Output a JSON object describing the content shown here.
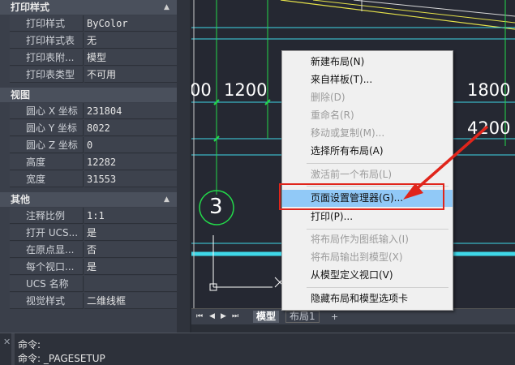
{
  "palette": {
    "sections": [
      {
        "title": "打印样式",
        "rows": [
          {
            "key": "打印样式",
            "value": "ByColor"
          },
          {
            "key": "打印样式表",
            "value": "无"
          },
          {
            "key": "打印表附...",
            "value": "模型"
          },
          {
            "key": "打印表类型",
            "value": "不可用"
          }
        ]
      },
      {
        "title": "视图",
        "rows": [
          {
            "key": "圆心 X 坐标",
            "value": "231804"
          },
          {
            "key": "圆心 Y 坐标",
            "value": "8022"
          },
          {
            "key": "圆心 Z 坐标",
            "value": "0"
          },
          {
            "key": "高度",
            "value": "12282"
          },
          {
            "key": "宽度",
            "value": "31553"
          }
        ]
      },
      {
        "title": "其他",
        "rows": [
          {
            "key": "注释比例",
            "value": "1:1"
          },
          {
            "key": "打开 UCS...",
            "value": "是"
          },
          {
            "key": "在原点显...",
            "value": "否"
          },
          {
            "key": "每个视口...",
            "value": "是"
          },
          {
            "key": "UCS 名称",
            "value": ""
          },
          {
            "key": "视觉样式",
            "value": "二维线框"
          }
        ]
      }
    ]
  },
  "drawing": {
    "dims": [
      "00",
      "1200",
      "1800",
      "4200"
    ],
    "axis_bubble": "3"
  },
  "tabs": {
    "model": "模型",
    "layout1": "布局1",
    "add": "+"
  },
  "command": {
    "line1": "命令:",
    "line2": "命令: _PAGESETUP"
  },
  "context_menu": {
    "items": [
      {
        "label": "新建布局(N)",
        "enabled": true
      },
      {
        "label": "来自样板(T)...",
        "enabled": true
      },
      {
        "label": "删除(D)",
        "enabled": false
      },
      {
        "label": "重命名(R)",
        "enabled": false
      },
      {
        "label": "移动或复制(M)...",
        "enabled": false
      },
      {
        "label": "选择所有布局(A)",
        "enabled": true
      },
      {
        "label": "激活前一个布局(L)",
        "enabled": false
      },
      {
        "label": "页面设置管理器(G)...",
        "enabled": true,
        "highlighted": true
      },
      {
        "label": "打印(P)...",
        "enabled": true
      },
      {
        "label": "将布局作为图纸输入(I)",
        "enabled": false
      },
      {
        "label": "将布局输出到模型(X)",
        "enabled": false
      },
      {
        "label": "从模型定义视口(V)",
        "enabled": true
      },
      {
        "label": "隐藏布局和模型选项卡",
        "enabled": true
      }
    ]
  },
  "colors": {
    "annotation": "#e0251b",
    "grid_cyan": "#3fd7e8",
    "grid_green": "#23d94a",
    "menu_highlight": "#91c9f7"
  }
}
